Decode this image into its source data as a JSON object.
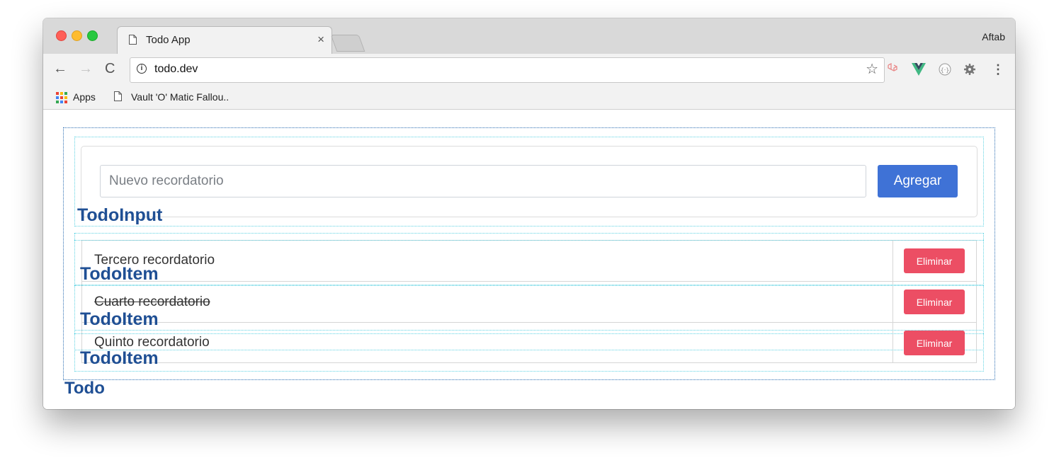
{
  "browser": {
    "tab_title": "Todo App",
    "tab_close": "×",
    "profile_name": "Aftab",
    "url": "todo.dev",
    "back_glyph": "←",
    "forward_glyph": "→",
    "reload_glyph": "C",
    "star_glyph": "☆",
    "menu_glyph": "⋮",
    "bookmarks": [
      {
        "label": "Apps",
        "icon": "apps-grid-icon"
      },
      {
        "label": "Vault 'O' Matic Fallou..",
        "icon": "document-icon"
      }
    ],
    "extensions": [
      "laravel-icon",
      "vue-devtools-icon",
      "json-viewer-icon",
      "settings-gear-icon"
    ]
  },
  "todo_input": {
    "placeholder": "Nuevo recordatorio",
    "value": "",
    "add_label": "Agregar",
    "component_label": "TodoInput"
  },
  "todo_items": [
    {
      "text": "Tercero recordatorio",
      "completed": false,
      "delete_label": "Eliminar",
      "component_label": "TodoItem"
    },
    {
      "text": "Cuarto recordatorio",
      "completed": true,
      "delete_label": "Eliminar",
      "component_label": "TodoItem"
    },
    {
      "text": "Quinto recordatorio",
      "completed": false,
      "delete_label": "Eliminar",
      "component_label": "TodoItem"
    }
  ],
  "todo_component_label": "Todo",
  "colors": {
    "primary": "#3f72d6",
    "danger": "#ec4e64",
    "component_label": "#1f4f94",
    "outline_outer": "#2f6fb3",
    "outline_inner": "#5fd3e3"
  }
}
